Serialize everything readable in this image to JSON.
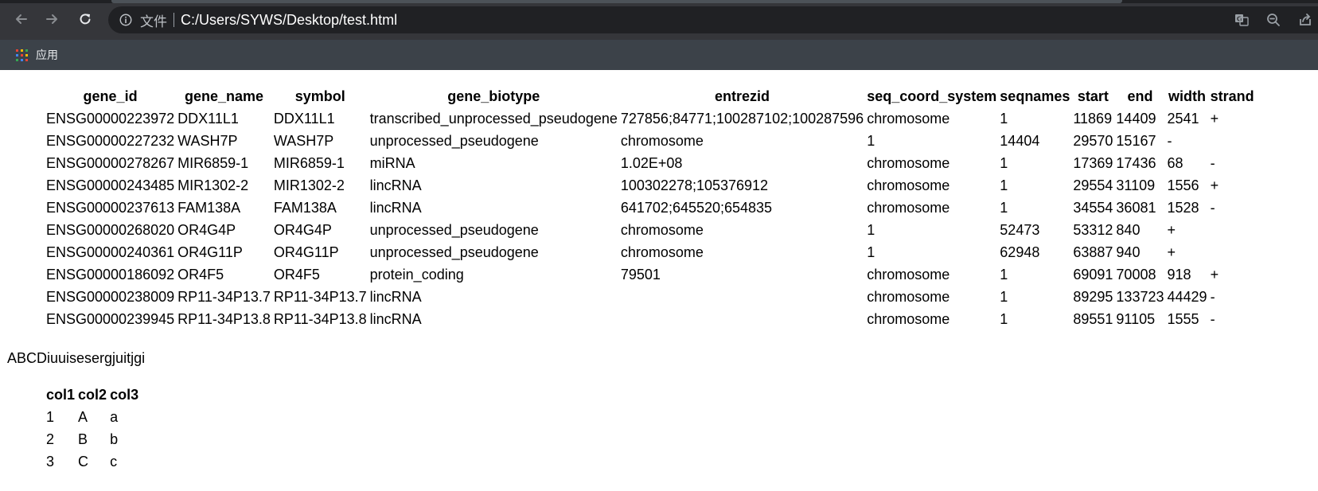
{
  "browser": {
    "scheme_label": "文件",
    "url": "C:/Users/SYWS/Desktop/test.html",
    "bookmarks": [
      {
        "label": "应用"
      }
    ],
    "colors": {
      "chrome": "#35363a",
      "omnibox": "#202124",
      "bookmark_bar": "#3c4249"
    }
  },
  "table1": {
    "headers": [
      "gene_id",
      "gene_name",
      "symbol",
      "gene_biotype",
      "entrezid",
      "seq_coord_system",
      "seqnames",
      "start",
      "end",
      "width",
      "strand"
    ],
    "rows": [
      [
        "ENSG00000223972",
        "DDX11L1",
        "DDX11L1",
        "transcribed_unprocessed_pseudogene",
        "727856;84771;100287102;100287596",
        "chromosome",
        "1",
        "11869",
        "14409",
        "2541",
        "+"
      ],
      [
        "ENSG00000227232",
        "WASH7P",
        "WASH7P",
        "unprocessed_pseudogene",
        "chromosome",
        "1",
        "14404",
        "29570",
        "15167",
        "-",
        ""
      ],
      [
        "ENSG00000278267",
        "MIR6859-1",
        "MIR6859-1",
        "miRNA",
        "1.02E+08",
        "chromosome",
        "1",
        "17369",
        "17436",
        "68",
        "-"
      ],
      [
        "ENSG00000243485",
        "MIR1302-2",
        "MIR1302-2",
        "lincRNA",
        "100302278;105376912",
        "chromosome",
        "1",
        "29554",
        "31109",
        "1556",
        "+"
      ],
      [
        "ENSG00000237613",
        "FAM138A",
        "FAM138A",
        "lincRNA",
        "641702;645520;654835",
        "chromosome",
        "1",
        "34554",
        "36081",
        "1528",
        "-"
      ],
      [
        "ENSG00000268020",
        "OR4G4P",
        "OR4G4P",
        "unprocessed_pseudogene",
        "chromosome",
        "1",
        "52473",
        "53312",
        "840",
        "+",
        ""
      ],
      [
        "ENSG00000240361",
        "OR4G11P",
        "OR4G11P",
        "unprocessed_pseudogene",
        "chromosome",
        "1",
        "62948",
        "63887",
        "940",
        "+",
        ""
      ],
      [
        "ENSG00000186092",
        "OR4F5",
        "OR4F5",
        "protein_coding",
        "79501",
        "chromosome",
        "1",
        "69091",
        "70008",
        "918",
        "+"
      ],
      [
        "ENSG00000238009",
        "RP11-34P13.7",
        "RP11-34P13.7",
        "lincRNA",
        "",
        "chromosome",
        "1",
        "89295",
        "133723",
        "44429",
        "-"
      ],
      [
        "ENSG00000239945",
        "RP11-34P13.8",
        "RP11-34P13.8",
        "lincRNA",
        "",
        "chromosome",
        "1",
        "89551",
        "91105",
        "1555",
        "-"
      ]
    ]
  },
  "paragraph": "ABCDiuuisesergjuitjgi",
  "table2": {
    "headers": [
      "col1",
      "col2",
      "col3"
    ],
    "rows": [
      [
        "1",
        "A",
        "a"
      ],
      [
        "2",
        "B",
        "b"
      ],
      [
        "3",
        "C",
        "c"
      ]
    ]
  }
}
